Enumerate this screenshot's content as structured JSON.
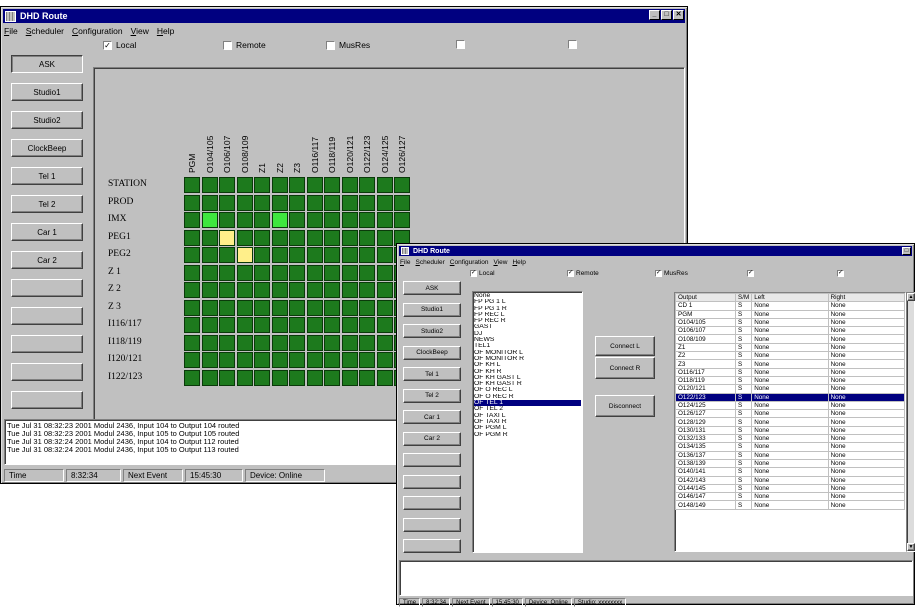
{
  "w1": {
    "title": "DHD Route",
    "menu": [
      "File",
      "Scheduler",
      "Configuration",
      "View",
      "Help"
    ],
    "checks": [
      {
        "label": "Local",
        "checked": true
      },
      {
        "label": "Remote",
        "checked": false
      },
      {
        "label": "MusRes",
        "checked": false
      },
      {
        "label": "",
        "checked": false
      },
      {
        "label": "",
        "checked": false
      }
    ],
    "buttons": [
      "ASK",
      "Studio1",
      "Studio2",
      "ClockBeep",
      "Tel 1",
      "Tel 2",
      "Car 1",
      "Car 2",
      "",
      "",
      "",
      "",
      ""
    ],
    "cols": [
      "PGM",
      "O104/105",
      "O106/107",
      "O108/109",
      "Z1",
      "Z2",
      "Z3",
      "O116/117",
      "O118/119",
      "O120/121",
      "O122/123",
      "O124/125",
      "O126/127"
    ],
    "rows": [
      "STATION",
      "PROD",
      "IMX",
      "PEG1",
      "PEG2",
      "Z 1",
      "Z 2",
      "Z 3",
      "I116/117",
      "I118/119",
      "I120/121",
      "I122/123"
    ],
    "active": [
      {
        "r": 2,
        "c": 1,
        "color": "#3ee63e"
      },
      {
        "r": 2,
        "c": 5,
        "color": "#3ee63e"
      },
      {
        "r": 3,
        "c": 2,
        "color": "#ffef8a"
      },
      {
        "r": 4,
        "c": 3,
        "color": "#ffef8a"
      }
    ],
    "log": [
      "Tue Jul 31 08:32:23 2001 Modul 2436,  Input 104 to Output 104 routed",
      "Tue Jul 31 08:32:23 2001 Modul 2436,  Input 105 to Output 105 routed",
      "Tue Jul 31 08:32:24 2001 Modul 2436,  Input 104 to Output 112 routed",
      "Tue Jul 31 08:32:24 2001 Modul 2436,  Input 105 to Output 113 routed"
    ],
    "status": [
      "Time",
      "8:32:34",
      "Next Event",
      "15:45:30",
      "Device: Online"
    ]
  },
  "w2": {
    "title": "DHD Route",
    "menu": [
      "File",
      "Scheduler",
      "Configuration",
      "View",
      "Help"
    ],
    "checks": [
      {
        "label": "Local",
        "checked": true
      },
      {
        "label": "Remote",
        "checked": true
      },
      {
        "label": "MusRes",
        "checked": true
      },
      {
        "label": "",
        "checked": true
      },
      {
        "label": "",
        "checked": true
      }
    ],
    "buttons": [
      "ASK",
      "Studio1",
      "Studio2",
      "ClockBeep",
      "Tel 1",
      "Tel 2",
      "Car 1",
      "Car 2",
      "",
      "",
      "",
      "",
      ""
    ],
    "inputs": [
      "None",
      "FP PG 1 L",
      "FP PG 1 R",
      "FP REC L",
      "FP REC R",
      "GAST",
      "DJ",
      "NEWS",
      "TEL1",
      "OF MONITOR L",
      "OF MONITOR R",
      "OF KH L",
      "OF KH R",
      "OF KH GAST L",
      "OF KH GAST R",
      "OF O REC L",
      "OF O REC R",
      "OF TEL 1",
      "OF TEL 2",
      "OF TAXI L",
      "OF TAXI R",
      "OF PGM L",
      "OF PGM R"
    ],
    "selected_input": "OF TEL 1",
    "connect_l": "Connect L",
    "connect_r": "Connect R",
    "disconnect": "Disconnect",
    "table_headers": [
      "Output",
      "S/M",
      "Left",
      "Right"
    ],
    "outputs": [
      [
        "CD 1",
        "S",
        "None",
        "None"
      ],
      [
        "PGM",
        "S",
        "None",
        "None"
      ],
      [
        "O104/105",
        "S",
        "None",
        "None"
      ],
      [
        "O106/107",
        "S",
        "None",
        "None"
      ],
      [
        "O108/109",
        "S",
        "None",
        "None"
      ],
      [
        "Z1",
        "S",
        "None",
        "None"
      ],
      [
        "Z2",
        "S",
        "None",
        "None"
      ],
      [
        "Z3",
        "S",
        "None",
        "None"
      ],
      [
        "O116/117",
        "S",
        "None",
        "None"
      ],
      [
        "O118/119",
        "S",
        "None",
        "None"
      ],
      [
        "O120/121",
        "S",
        "None",
        "None"
      ],
      [
        "O122/123",
        "S",
        "None",
        "None"
      ],
      [
        "O124/125",
        "S",
        "None",
        "None"
      ],
      [
        "O126/127",
        "S",
        "None",
        "None"
      ],
      [
        "O128/129",
        "S",
        "None",
        "None"
      ],
      [
        "O130/131",
        "S",
        "None",
        "None"
      ],
      [
        "O132/133",
        "S",
        "None",
        "None"
      ],
      [
        "O134/135",
        "S",
        "None",
        "None"
      ],
      [
        "O136/137",
        "S",
        "None",
        "None"
      ],
      [
        "O138/139",
        "S",
        "None",
        "None"
      ],
      [
        "O140/141",
        "S",
        "None",
        "None"
      ],
      [
        "O142/143",
        "S",
        "None",
        "None"
      ],
      [
        "O144/145",
        "S",
        "None",
        "None"
      ],
      [
        "O146/147",
        "S",
        "None",
        "None"
      ],
      [
        "O148/149",
        "S",
        "None",
        "None"
      ]
    ],
    "selected_output": "O122/123",
    "status": [
      "Time",
      "8:32:34",
      "Next Event",
      "15:45:30",
      "Device: Online",
      "Studio: xxxxxxxx"
    ]
  }
}
